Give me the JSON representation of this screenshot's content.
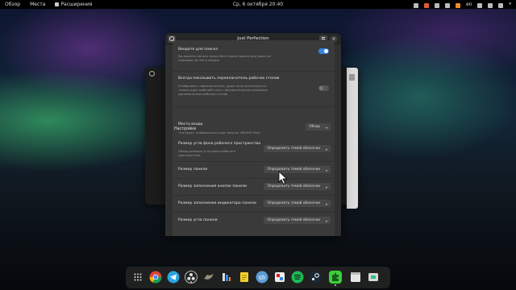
{
  "topbar": {
    "overview": "Обзор",
    "places": "Места",
    "extensions": "Расширения",
    "clock": "Ср, 6 октября  20:40",
    "keyboard_layout": "en"
  },
  "window": {
    "title": "Just Perfection",
    "close_glyph": "×",
    "rows": [
      {
        "title": "Введите для поиска",
        "subtitle": "Вы можете начать поиск без строки поиска или даже не нажимая на неё в обзоре",
        "toggle": "on"
      },
      {
        "title": "Всегда показывать переключатель рабочих столов",
        "subtitle": "Отображает переключатель, даже если используется только один рабочий стол с автоматическим режимом динамических рабочих столов",
        "toggle": "off"
      },
      {
        "title": "Место входа",
        "subtitle": "Что будет отображаться при запуске GNOME Shell",
        "dropdown": "Обзор"
      }
    ],
    "section_title": "Настройки",
    "settings": [
      {
        "title": "Размер угла фона рабочего пространства",
        "subtitle": "Обзор размера угла фона рабочего пространства",
        "dropdown": "Определить темой оболочки"
      },
      {
        "title": "Размер панели",
        "dropdown": "Определить темой оболочки"
      },
      {
        "title": "Размер заполнения кнопок панели",
        "dropdown": "Определить темой оболочки"
      },
      {
        "title": "Размер заполнения индикатора панели",
        "dropdown": "Определить темой оболочки"
      },
      {
        "title": "Размер угла панели",
        "dropdown": "Определить темой оболочки"
      }
    ],
    "chevron": "▾"
  },
  "colors": {
    "accent": "#3584e4",
    "window_bg": "#303030",
    "card_bg": "#3a3a3a",
    "extension_icon": "#3bd13b"
  },
  "dock": {
    "apps": [
      "app-grid-icon",
      "chrome-icon",
      "telegram-icon",
      "obs-icon",
      "wolf-icon",
      "scripts-icon",
      "notes-icon",
      "qbittorrent-icon",
      "photos-icon",
      "spotify-icon",
      "steam-icon",
      "extensions-icon",
      "files-icon",
      "disks-icon"
    ]
  }
}
